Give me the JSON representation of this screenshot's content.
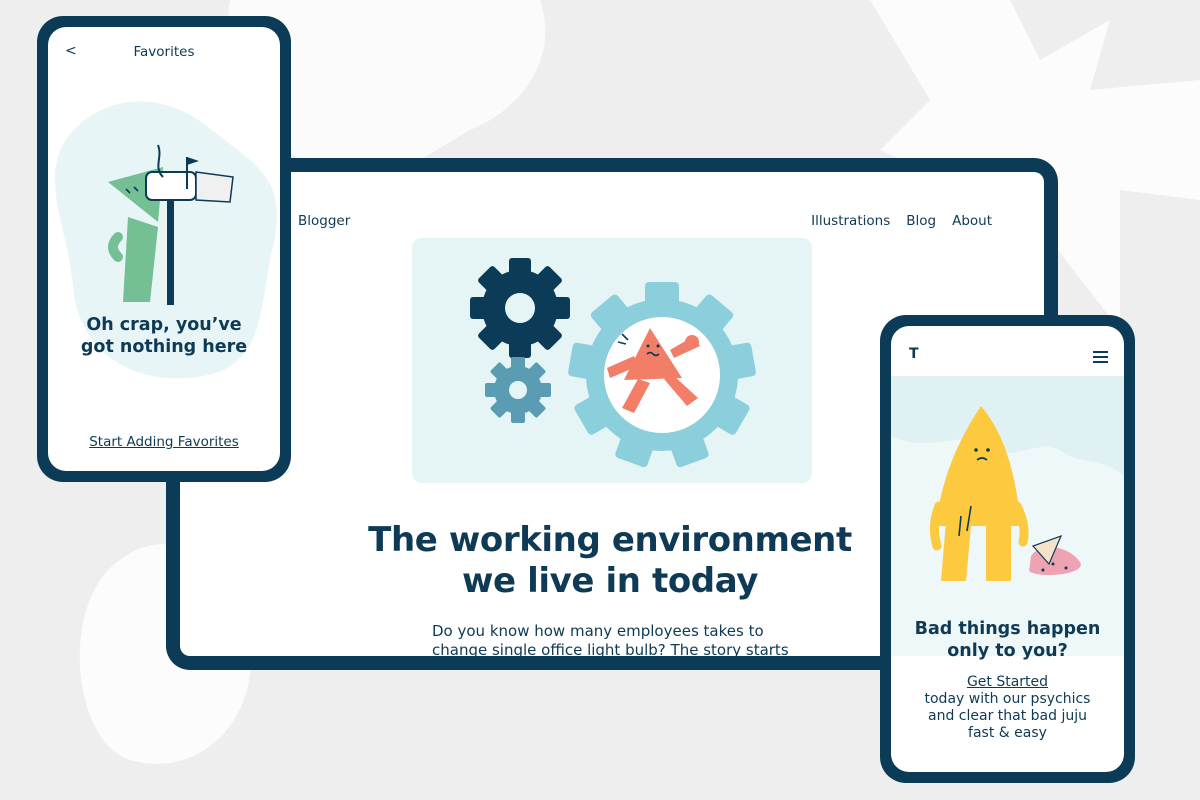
{
  "tablet": {
    "brand": "Blogger",
    "nav": [
      "Illustrations",
      "Blog",
      "About"
    ],
    "headline_line1": "The working environment",
    "headline_line2": "we live in today",
    "body": "Do you know how many employees takes to change single office light bulb? The story starts with intern on the coffee run to the Starbucks"
  },
  "phone_left": {
    "back_icon": "chevron-left-icon",
    "title": "Favorites",
    "heading_line1": "Oh crap, you’ve",
    "heading_line2": "got nothing here",
    "cta": "Start Adding Favorites"
  },
  "phone_right": {
    "logo": "T",
    "menu_icon": "hamburger-menu-icon",
    "heading_line1": "Bad things happen",
    "heading_line2": "only to you?",
    "cta": "Get Started",
    "subtext": "today with our psychics\nand clear that bad juju\nfast & easy"
  },
  "colors": {
    "navy": "#0c3b57",
    "background": "#eeeeef",
    "pale_teal": "#e5f4f5",
    "gear_blue": "#8ccfdc",
    "gear_slate": "#5a9db3",
    "coral": "#f27e67",
    "yellow": "#fcc93f",
    "green": "#74bf93",
    "pink": "#eea3b2"
  }
}
